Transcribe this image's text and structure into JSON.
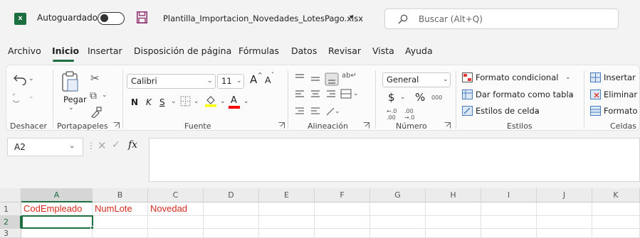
{
  "titlebar": {
    "app_icon_letter": "x",
    "autosave_label": "Autoguardado",
    "autosave_state": "off",
    "file_name": "Plantilla_Importacion_Novedades_LotesPago.xlsx",
    "search_placeholder": "Buscar (Alt+Q)"
  },
  "menu": {
    "tabs": [
      "Archivo",
      "Inicio",
      "Insertar",
      "Disposición de página",
      "Fórmulas",
      "Datos",
      "Revisar",
      "Vista",
      "Ayuda"
    ],
    "active_tab": "Inicio"
  },
  "ribbon": {
    "undo_group": "Deshacer",
    "clipboard_group": "Portapapeles",
    "paste_label": "Pegar",
    "font_group": "Fuente",
    "font_name": "Calibri",
    "font_size": "11",
    "grow_font": "A",
    "shrink_font": "A",
    "bold": "N",
    "italic": "K",
    "underline": "S",
    "font_color_letter": "A",
    "alignment_group": "Alineación",
    "number_group": "Número",
    "number_format": "General",
    "currency": "$",
    "percent": "%",
    "thousands": "000",
    "styles_group": "Estilos",
    "conditional_format": "Formato condicional",
    "format_as_table": "Dar formato como tabla",
    "cell_styles": "Estilos de celda",
    "cells_group": "Celdas",
    "insert": "Insertar",
    "delete": "Eliminar",
    "format": "Formato"
  },
  "formula_bar": {
    "name_box": "A2",
    "fx": "fx",
    "content": ""
  },
  "sheet": {
    "columns": [
      "A",
      "B",
      "C",
      "D",
      "E",
      "F",
      "G",
      "H",
      "I",
      "J",
      "K"
    ],
    "rows": [
      "1",
      "2",
      "3"
    ],
    "cells": {
      "A1": "CodEmpleado",
      "B1": "NumLote",
      "C1": "Novedad"
    },
    "active_cell": "A2",
    "text_color": "#d52b1e",
    "accent": "#1d6f42"
  }
}
